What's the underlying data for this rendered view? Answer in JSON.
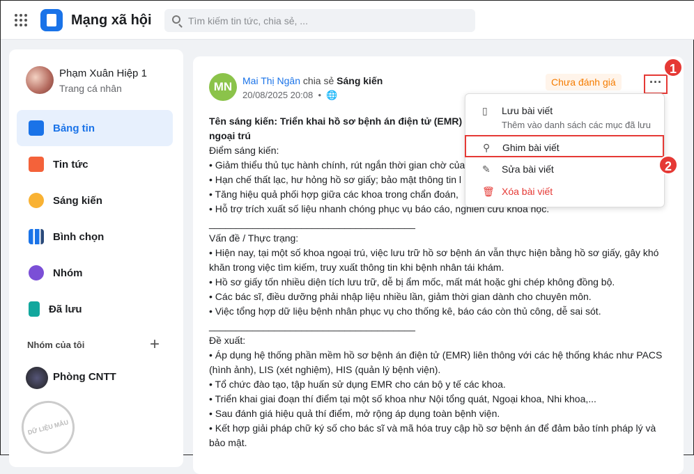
{
  "app": {
    "title": "Mạng xã hội",
    "search_placeholder": "Tìm kiếm tin tức, chia sẻ, ..."
  },
  "profile": {
    "name": "Phạm Xuân Hiệp 1",
    "sub": "Trang cá nhân"
  },
  "nav": [
    "Bảng tin",
    "Tin tức",
    "Sáng kiến",
    "Bình chọn",
    "Nhóm",
    "Đã lưu"
  ],
  "groups": {
    "title": "Nhóm của tôi",
    "plus": "+",
    "items": [
      "Phòng CNTT"
    ]
  },
  "watermark": "DỮ LIỆU MẪU",
  "post": {
    "initials": "MN",
    "author": "Mai Thị Ngân",
    "action": "chia sẻ",
    "category": "Sáng kiến",
    "time": "20/08/2025 20:08",
    "dot": "•",
    "badge": "Chưa đánh giá",
    "more": "···",
    "title": "Tên sáng kiến: Triển khai hồ sơ bệnh án điện tử (EMR) tha... ngoại trú",
    "title1": "Tên sáng kiến: Triển khai hồ sơ bệnh án điện tử (EMR) tha",
    "title2": "ngoại trú",
    "lines": [
      "Điểm sáng kiến:",
      "• Giảm thiểu thủ tục hành chính, rút ngắn thời gian chờ của",
      "• Hạn chế thất lạc, hư hỏng hồ sơ giấy; bảo mật thông tin l",
      "• Tăng hiệu quả phối hợp giữa các khoa trong chẩn đoán,",
      "• Hỗ trợ trích xuất số liệu nhanh chóng phục vụ báo cáo, nghiên cứu khoa học.",
      "______________________________________",
      "Vấn đề / Thực trạng:",
      "• Hiện nay, tại một số khoa ngoại trú, việc lưu trữ hồ sơ bệnh án vẫn thực hiện bằng hồ sơ giấy, gây khó khăn trong việc tìm kiếm, truy xuất thông tin khi bệnh nhân tái khám.",
      "• Hồ sơ giấy tốn nhiều diện tích lưu trữ, dễ bị ẩm mốc, mất mát hoặc ghi chép không đồng bộ.",
      "• Các bác sĩ, điều dưỡng phải nhập liệu nhiều lần, giảm thời gian dành cho chuyên môn.",
      "• Việc tổng hợp dữ liệu bệnh nhân phục vụ cho thống kê, báo cáo còn thủ công, dễ sai sót.",
      "______________________________________",
      "Đề xuất:",
      "• Áp dụng hệ thống phần mềm hồ sơ bệnh án điện tử (EMR) liên thông với các hệ thống khác như PACS (hình ảnh), LIS (xét nghiệm), HIS (quản lý bệnh viện).",
      "• Tổ chức đào tạo, tập huấn sử dụng EMR cho cán bộ y tế các khoa.",
      "• Triển khai giai đoạn thí điểm tại một số khoa như Nội tổng quát, Ngoại khoa, Nhi khoa,...",
      "• Sau đánh giá hiệu quả thí điểm, mở rộng áp dụng toàn bệnh viện.",
      "• Kết hợp giải pháp chữ ký số cho bác sĩ và mã hóa truy cập hồ sơ bệnh án để đảm bảo tính pháp lý và bảo mật."
    ]
  },
  "menu": {
    "save": "Lưu bài viết",
    "save_sub": "Thêm vào danh sách các mục đã lưu",
    "pin": "Ghim bài viết",
    "edit": "Sửa bài viết",
    "delete": "Xóa bài viết"
  },
  "steps": [
    "1",
    "2"
  ],
  "colors": {
    "accent": "#1a73e8",
    "danger": "#e53935",
    "badge": "#f57c00"
  }
}
